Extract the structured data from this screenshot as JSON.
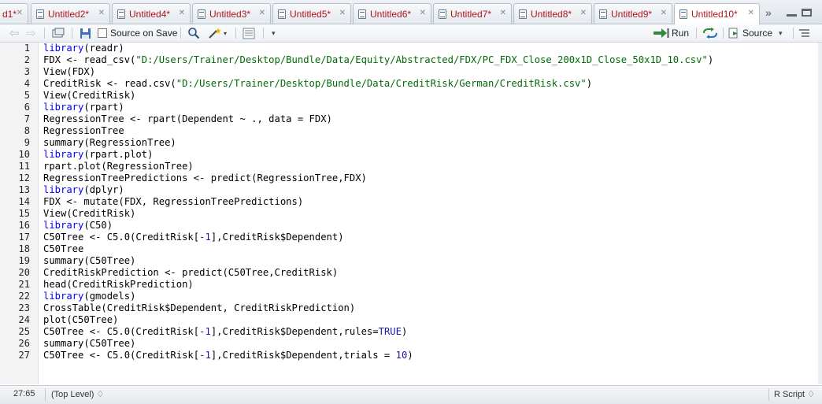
{
  "tabs": [
    {
      "label": "d1*"
    },
    {
      "label": "Untitled2*"
    },
    {
      "label": "Untitled4*"
    },
    {
      "label": "Untitled3*"
    },
    {
      "label": "Untitled5*"
    },
    {
      "label": "Untitled6*"
    },
    {
      "label": "Untitled7*"
    },
    {
      "label": "Untitled8*"
    },
    {
      "label": "Untitled9*"
    },
    {
      "label": "Untitled10*"
    }
  ],
  "toolbar": {
    "source_on_save_label": "Source on Save",
    "run_label": "Run",
    "source_label": "Source"
  },
  "editor": {
    "line_numbers": [
      "1",
      "2",
      "3",
      "4",
      "5",
      "6",
      "7",
      "8",
      "9",
      "10",
      "11",
      "12",
      "13",
      "14",
      "15",
      "16",
      "17",
      "18",
      "19",
      "20",
      "21",
      "22",
      "23",
      "24",
      "25",
      "26",
      "27"
    ],
    "lines": [
      "library(readr)",
      "FDX <- read_csv(\"D:/Users/Trainer/Desktop/Bundle/Data/Equity/Abstracted/FDX/PC_FDX_Close_200x1D_Close_50x1D_10.csv\")",
      "View(FDX)",
      "CreditRisk <- read.csv(\"D:/Users/Trainer/Desktop/Bundle/Data/CreditRisk/German/CreditRisk.csv\")",
      "View(CreditRisk)",
      "library(rpart)",
      "RegressionTree <- rpart(Dependent ~ ., data = FDX)",
      "RegressionTree",
      "summary(RegressionTree)",
      "library(rpart.plot)",
      "rpart.plot(RegressionTree)",
      "RegressionTreePredictions <- predict(RegressionTree,FDX)",
      "library(dplyr)",
      "FDX <- mutate(FDX, RegressionTreePredictions)",
      "View(CreditRisk)",
      "library(C50)",
      "C50Tree <- C5.0(CreditRisk[-1],CreditRisk$Dependent)",
      "C50Tree",
      "summary(C50Tree)",
      "CreditRiskPrediction <- predict(C50Tree,CreditRisk)",
      "head(CreditRiskPrediction)",
      "library(gmodels)",
      "CrossTable(CreditRisk$Dependent, CreditRiskPrediction)",
      "plot(C50Tree)",
      "C50Tree <- C5.0(CreditRisk[-1],CreditRisk$Dependent,rules=TRUE)",
      "summary(C50Tree)",
      "C50Tree <- C5.0(CreditRisk[-1],CreditRisk$Dependent,trials = 10)"
    ]
  },
  "status": {
    "position": "27:65",
    "scope": "(Top Level) ♢",
    "filetype": "R Script ♢"
  },
  "colors": {
    "keyword": "#0000ff",
    "string": "#036a07",
    "number": "#1a1aa6",
    "tab_text": "#b0151a"
  }
}
